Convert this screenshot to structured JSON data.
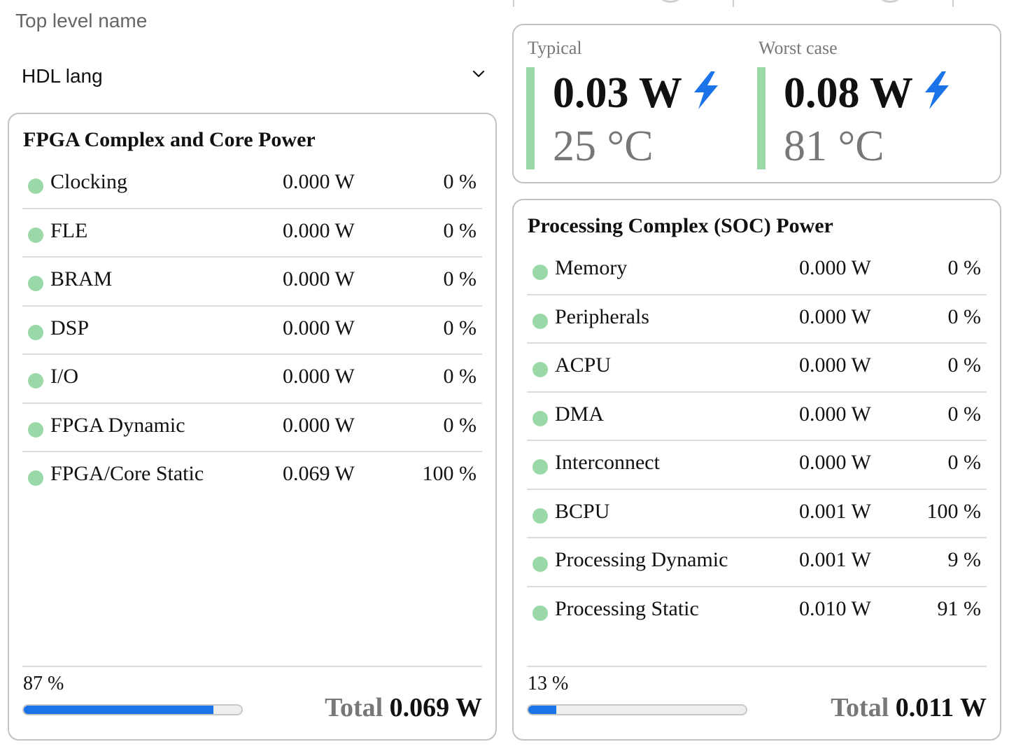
{
  "top_level_label": "Top level name",
  "hdl_select": {
    "value": "HDL lang"
  },
  "summary": {
    "typical": {
      "label": "Typical",
      "power": "0.03 W",
      "temp": "25 °C"
    },
    "worst": {
      "label": "Worst case",
      "power": "0.08 W",
      "temp": "81 °C"
    }
  },
  "fpga": {
    "title": "FPGA Complex and Core Power",
    "rows": [
      {
        "name": "Clocking",
        "power": "0.000 W",
        "pct": "0 %"
      },
      {
        "name": "FLE",
        "power": "0.000 W",
        "pct": "0 %"
      },
      {
        "name": "BRAM",
        "power": "0.000 W",
        "pct": "0 %"
      },
      {
        "name": "DSP",
        "power": "0.000 W",
        "pct": "0 %"
      },
      {
        "name": "I/O",
        "power": "0.000 W",
        "pct": "0 %"
      },
      {
        "name": "FPGA Dynamic",
        "power": "0.000 W",
        "pct": "0 %"
      },
      {
        "name": "FPGA/Core Static",
        "power": "0.069 W",
        "pct": "100 %"
      }
    ],
    "share_label": "87 %",
    "share_fraction": 0.87,
    "total_label": "Total",
    "total_value": "0.069 W"
  },
  "soc": {
    "title": "Processing Complex (SOC) Power",
    "rows": [
      {
        "name": "Memory",
        "power": "0.000 W",
        "pct": "0 %"
      },
      {
        "name": "Peripherals",
        "power": "0.000 W",
        "pct": "0 %"
      },
      {
        "name": "ACPU",
        "power": "0.000 W",
        "pct": "0 %"
      },
      {
        "name": "DMA",
        "power": "0.000 W",
        "pct": "0 %"
      },
      {
        "name": "Interconnect",
        "power": "0.000 W",
        "pct": "0 %"
      },
      {
        "name": "BCPU",
        "power": "0.001 W",
        "pct": "100 %"
      },
      {
        "name": "Processing Dynamic",
        "power": "0.001 W",
        "pct": "9 %"
      },
      {
        "name": "Processing Static",
        "power": "0.010 W",
        "pct": "91 %"
      }
    ],
    "share_label": "13 %",
    "share_fraction": 0.13,
    "total_label": "Total",
    "total_value": "0.011 W"
  },
  "colors": {
    "accent_blue": "#1a73e8",
    "status_green": "#9ad9a7",
    "border": "#c2c2c2"
  },
  "icons": {
    "select_chevron": "chevron-down-icon",
    "power": "lightning-bolt-icon",
    "status": "status-dot"
  }
}
